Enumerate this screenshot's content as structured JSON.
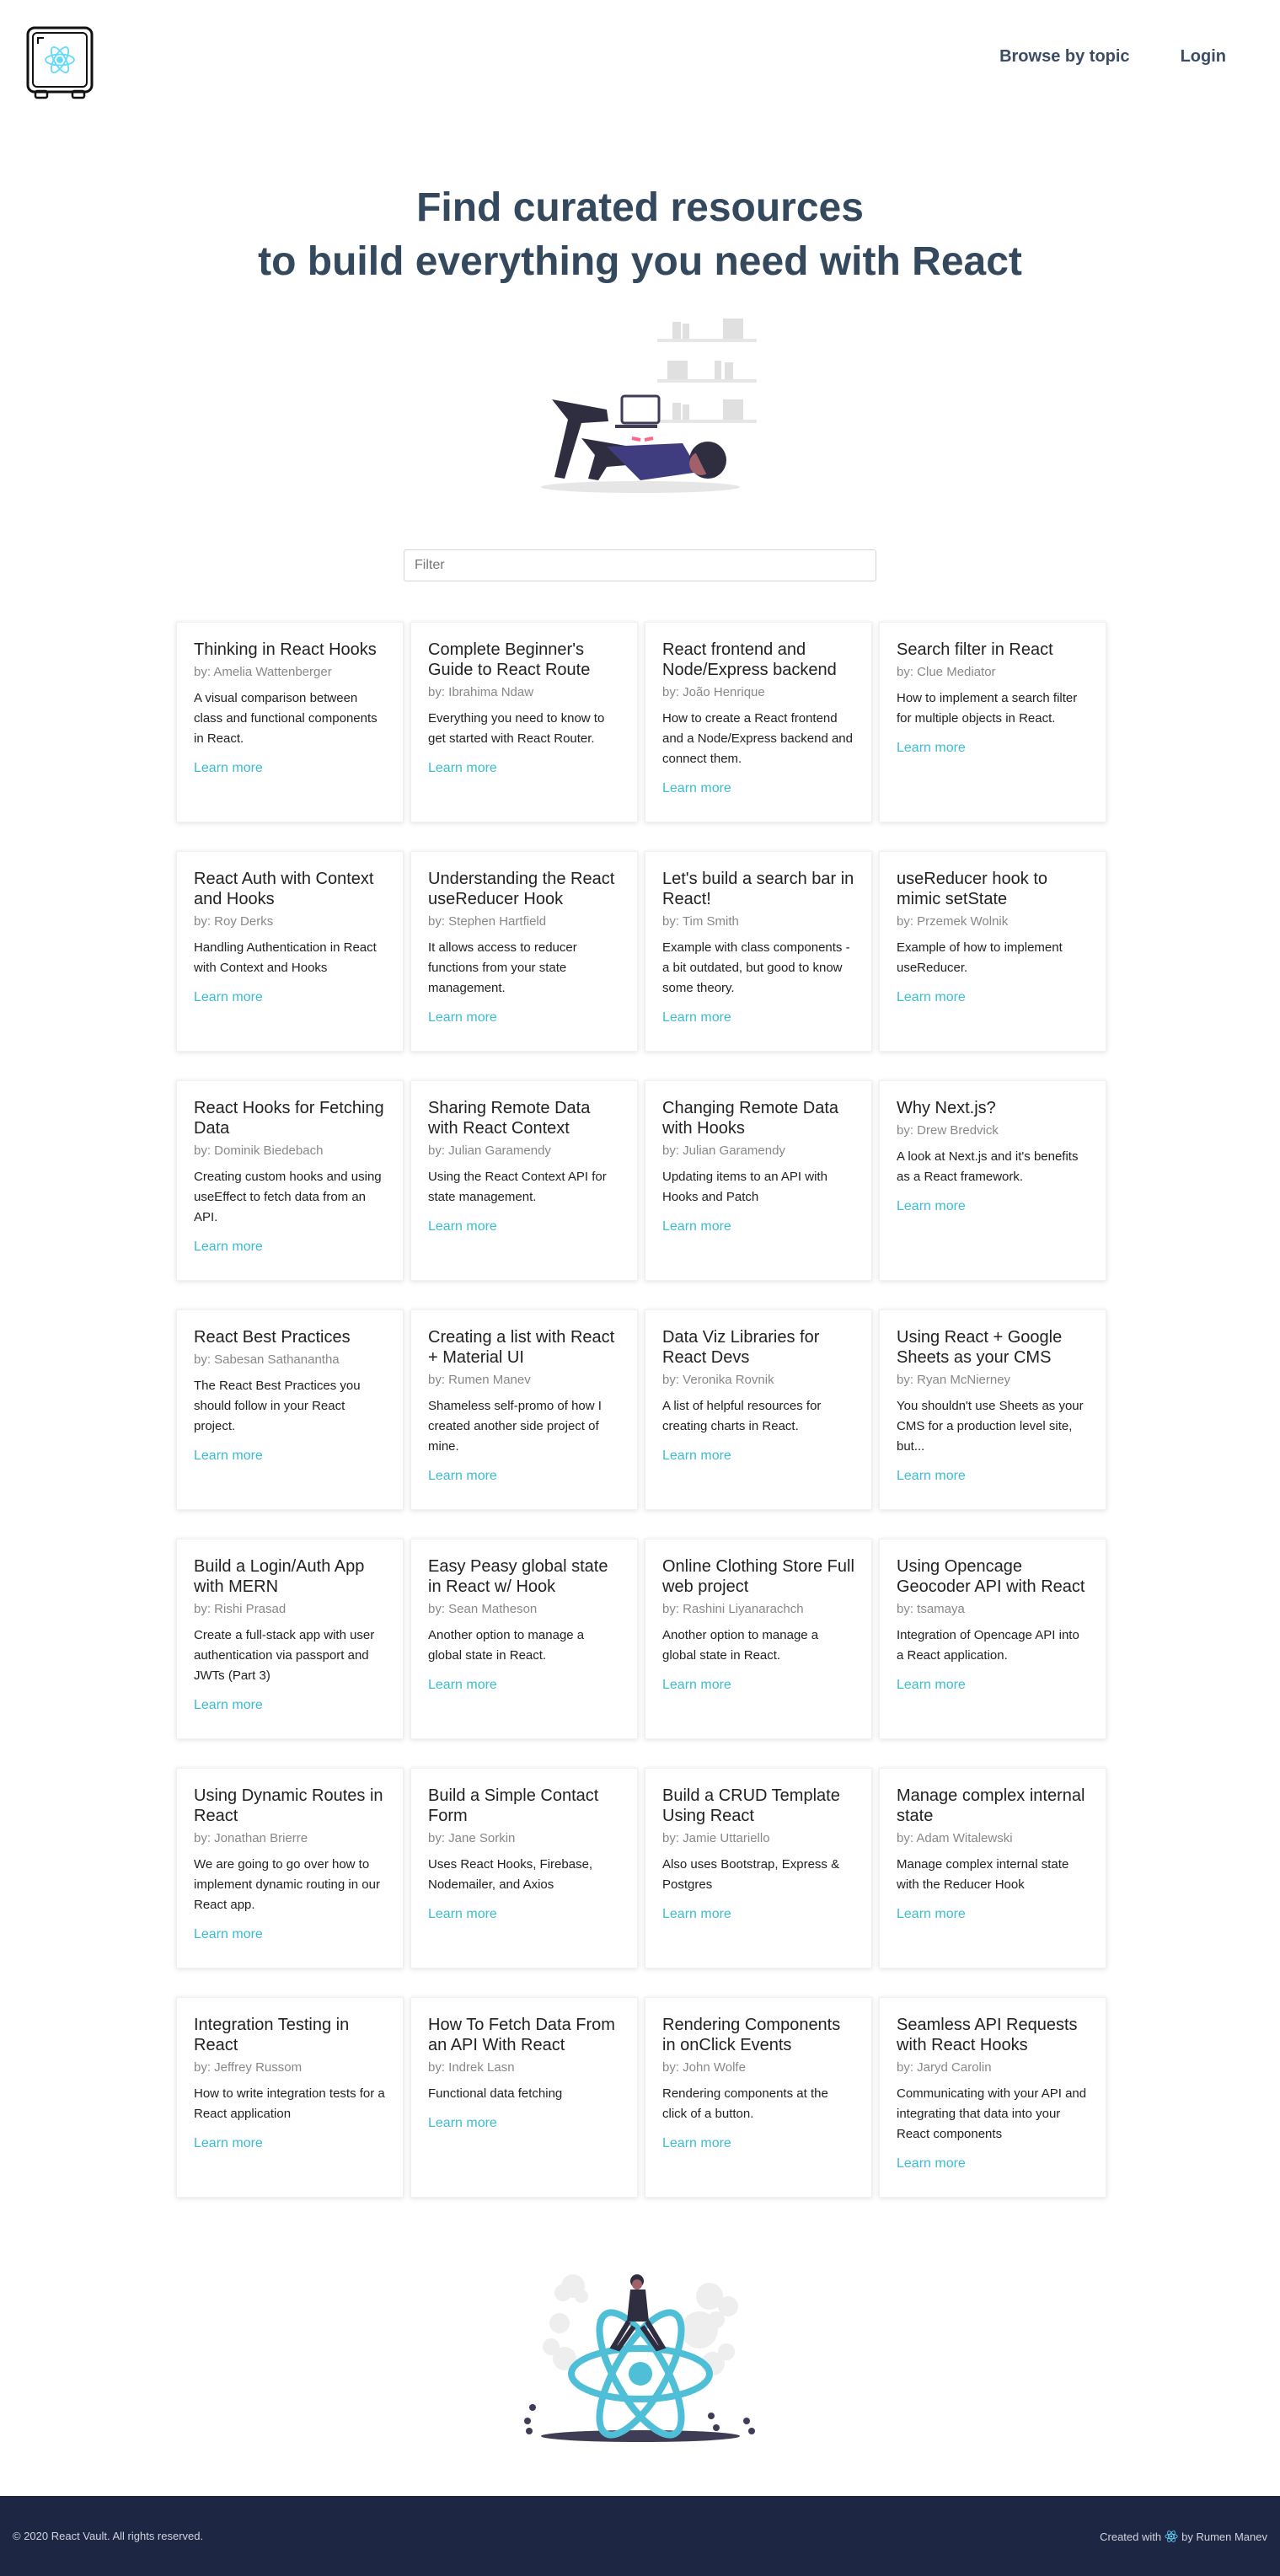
{
  "nav": {
    "browse_label": "Browse by topic",
    "login_label": "Login"
  },
  "hero": {
    "line1": "Find curated resources",
    "line2": "to build everything you need with React"
  },
  "filter": {
    "placeholder": "Filter"
  },
  "cards": [
    {
      "title": "Thinking in React Hooks",
      "author": "by: Amelia Wattenberger",
      "desc": "A visual comparison between class and functional components in React.",
      "link": "Learn more"
    },
    {
      "title": "Complete Beginner's Guide to React Route",
      "author": "by: Ibrahima Ndaw",
      "desc": "Everything you need to know to get started with React Router.",
      "link": "Learn more"
    },
    {
      "title": "React frontend and Node/Express backend",
      "author": "by: João Henrique",
      "desc": "How to create a React frontend and a Node/Express backend and connect them.",
      "link": "Learn more"
    },
    {
      "title": "Search filter in React",
      "author": "by: Clue Mediator",
      "desc": "How to implement a search filter for multiple objects in React.",
      "link": "Learn more"
    },
    {
      "title": "React Auth with Context and Hooks",
      "author": "by: Roy Derks",
      "desc": "Handling Authentication in React with Context and Hooks",
      "link": "Learn more"
    },
    {
      "title": "Understanding the React useReducer Hook",
      "author": "by: Stephen Hartfield",
      "desc": "It allows access to reducer functions from your state management.",
      "link": "Learn more"
    },
    {
      "title": "Let's build a search bar in React!",
      "author": "by: Tim Smith",
      "desc": "Example with class components - a bit outdated, but good to know some theory.",
      "link": "Learn more"
    },
    {
      "title": "useReducer hook to mimic setState",
      "author": "by: Przemek Wolnik",
      "desc": "Example of how to implement useReducer.",
      "link": "Learn more"
    },
    {
      "title": "React Hooks for Fetching Data",
      "author": "by: Dominik Biedebach",
      "desc": "Creating custom hooks and using useEffect to fetch data from an API.",
      "link": "Learn more"
    },
    {
      "title": "Sharing Remote Data with React Context",
      "author": "by: Julian Garamendy",
      "desc": "Using the React Context API for state management.",
      "link": "Learn more"
    },
    {
      "title": "Changing Remote Data with Hooks",
      "author": "by: Julian Garamendy",
      "desc": "Updating items to an API with Hooks and Patch",
      "link": "Learn more"
    },
    {
      "title": "Why Next.js?",
      "author": "by: Drew Bredvick",
      "desc": "A look at Next.js and it's benefits as a React framework.",
      "link": "Learn more"
    },
    {
      "title": "React Best Practices",
      "author": "by: Sabesan Sathanantha",
      "desc": "The React Best Practices you should follow in your React project.",
      "link": "Learn more"
    },
    {
      "title": "Creating a list with React + Material UI",
      "author": "by: Rumen Manev",
      "desc": "Shameless self-promo of how I created another side project of mine.",
      "link": "Learn more"
    },
    {
      "title": "Data Viz Libraries for React Devs",
      "author": "by: Veronika Rovnik",
      "desc": "A list of helpful resources for creating charts in React.",
      "link": "Learn more"
    },
    {
      "title": "Using React + Google Sheets as your CMS",
      "author": "by: Ryan McNierney",
      "desc": "You shouldn't use Sheets as your CMS for a production level site, but...",
      "link": "Learn more"
    },
    {
      "title": "Build a Login/Auth App with MERN",
      "author": "by: Rishi Prasad",
      "desc": "Create a full-stack app with user authentication via passport and JWTs (Part 3)",
      "link": "Learn more"
    },
    {
      "title": "Easy Peasy global state in React w/ Hook",
      "author": "by: Sean Matheson",
      "desc": "Another option to manage a global state in React.",
      "link": "Learn more"
    },
    {
      "title": "Online Clothing Store Full web project",
      "author": "by: Rashini Liyanarachch",
      "desc": "Another option to manage a global state in React.",
      "link": "Learn more"
    },
    {
      "title": "Using Opencage Geocoder API with React",
      "author": "by: tsamaya",
      "desc": "Integration of Opencage API into a React application.",
      "link": "Learn more"
    },
    {
      "title": "Using Dynamic Routes in React",
      "author": "by: Jonathan Brierre",
      "desc": "We are going to go over how to implement dynamic routing in our React app.",
      "link": "Learn more"
    },
    {
      "title": "Build a Simple Contact Form",
      "author": "by: Jane Sorkin",
      "desc": "Uses React Hooks, Firebase, Nodemailer, and Axios",
      "link": "Learn more"
    },
    {
      "title": "Build a CRUD Template Using React",
      "author": "by: Jamie Uttariello",
      "desc": "Also uses Bootstrap, Express & Postgres",
      "link": "Learn more"
    },
    {
      "title": "Manage complex internal state",
      "author": "by: Adam Witalewski",
      "desc": "Manage complex internal state with the Reducer Hook",
      "link": "Learn more"
    },
    {
      "title": "Integration Testing in React",
      "author": "by: Jeffrey Russom",
      "desc": "How to write integration tests for a React application",
      "link": "Learn more"
    },
    {
      "title": "How To Fetch Data From an API With React",
      "author": "by: Indrek Lasn",
      "desc": "Functional data fetching",
      "link": "Learn more"
    },
    {
      "title": "Rendering Components in onClick Events",
      "author": "by: John Wolfe",
      "desc": "Rendering components at the click of a button.",
      "link": "Learn more"
    },
    {
      "title": "Seamless API Requests with React Hooks",
      "author": "by: Jaryd Carolin",
      "desc": "Communicating with your API and integrating that data into your React components",
      "link": "Learn more"
    }
  ],
  "footer": {
    "copyright": "© 2020 React Vault. All rights reserved.",
    "created_with": "Created with",
    "by_author": "by Rumen Manev"
  },
  "colors": {
    "heading": "#34495e",
    "link": "#3bbdd0",
    "footer_bg": "#1d2642",
    "react_cyan": "#61dafb"
  }
}
